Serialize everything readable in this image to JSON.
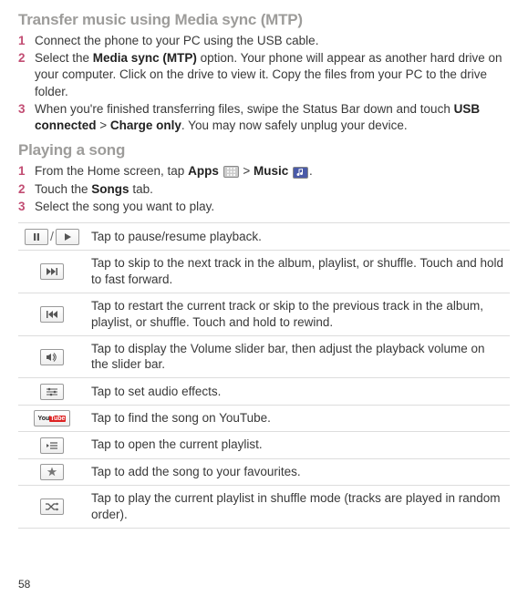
{
  "section1": {
    "title": "Transfer music using Media sync (MTP)",
    "steps": [
      {
        "num": "1",
        "segments": [
          {
            "t": "Connect the phone to your PC using the USB cable."
          }
        ]
      },
      {
        "num": "2",
        "segments": [
          {
            "t": "Select the "
          },
          {
            "t": "Media sync (MTP)",
            "b": true
          },
          {
            "t": " option. Your phone will appear as another hard drive on your computer. Click on the drive to view it. Copy the files from your PC to the drive folder."
          }
        ]
      },
      {
        "num": "3",
        "segments": [
          {
            "t": "When you're finished transferring files, swipe the Status Bar down and touch "
          },
          {
            "t": "USB connected",
            "b": true
          },
          {
            "t": " > "
          },
          {
            "t": "Charge only",
            "b": true
          },
          {
            "t": ". You may now safely unplug your device."
          }
        ]
      }
    ]
  },
  "section2": {
    "title": "Playing a song",
    "steps": [
      {
        "num": "1",
        "segments": [
          {
            "t": "From the Home screen, tap "
          },
          {
            "t": "Apps",
            "b": true
          },
          {
            "t": " "
          },
          {
            "icon": "apps-grid-icon"
          },
          {
            "t": " > "
          },
          {
            "t": "Music",
            "b": true
          },
          {
            "t": " "
          },
          {
            "icon": "music-app-icon"
          },
          {
            "t": "."
          }
        ]
      },
      {
        "num": "2",
        "segments": [
          {
            "t": "Touch the "
          },
          {
            "t": "Songs",
            "b": true
          },
          {
            "t": " tab."
          }
        ]
      },
      {
        "num": "3",
        "segments": [
          {
            "t": "Select the song you want to play."
          }
        ]
      }
    ]
  },
  "controls": [
    {
      "icons": [
        "pause-icon",
        "play-icon"
      ],
      "sep": "/",
      "desc": "Tap to pause/resume playback."
    },
    {
      "icons": [
        "next-track-icon"
      ],
      "desc": "Tap to skip to the next track in the album, playlist, or shuffle. Touch and hold to fast forward."
    },
    {
      "icons": [
        "prev-track-icon"
      ],
      "desc": "Tap to restart the current track or skip to the previous track in the album, playlist, or shuffle. Touch and hold to rewind."
    },
    {
      "icons": [
        "volume-icon"
      ],
      "desc": "Tap to display the Volume slider bar, then adjust the playback volume on the slider bar."
    },
    {
      "icons": [
        "equalizer-icon"
      ],
      "desc": "Tap to set audio effects."
    },
    {
      "icons": [
        "youtube-icon"
      ],
      "desc": "Tap to find the song on YouTube."
    },
    {
      "icons": [
        "playlist-icon"
      ],
      "desc": "Tap to open the current playlist."
    },
    {
      "icons": [
        "favourite-star-icon"
      ],
      "desc": "Tap to add the song to your favourites."
    },
    {
      "icons": [
        "shuffle-icon"
      ],
      "desc": "Tap to play the current playlist in shuffle mode (tracks are played in random order)."
    }
  ],
  "page_number": "58"
}
